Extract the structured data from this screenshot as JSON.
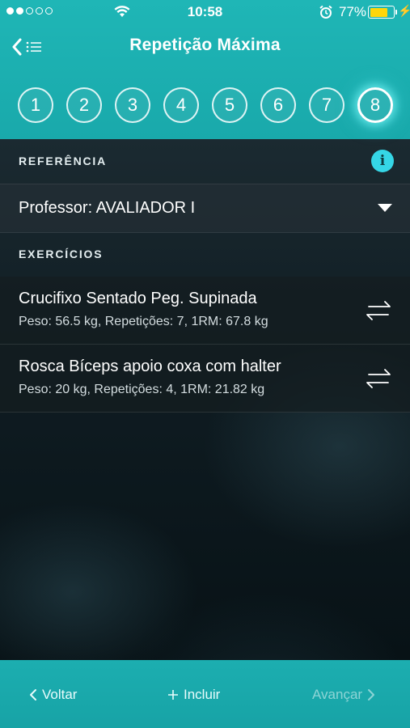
{
  "status_bar": {
    "time": "10:58",
    "battery_percent": "77%",
    "battery_level": 0.77,
    "battery_color": "#ffd60a",
    "signal_bars_filled": 2,
    "signal_bars_total": 5
  },
  "nav": {
    "title": "Repetição Máxima",
    "back_icon": "chevron-left-icon",
    "list_icon": "list-icon"
  },
  "steps": {
    "labels": [
      "1",
      "2",
      "3",
      "4",
      "5",
      "6",
      "7",
      "8"
    ],
    "active": "8"
  },
  "reference": {
    "section_label": "REFERÊNCIA",
    "info_icon": "i",
    "professor_label": "Professor: AVALIADOR I"
  },
  "exercises": {
    "section_label": "EXERCÍCIOS",
    "items": [
      {
        "name": "Crucifixo Sentado Peg. Supinada",
        "detail": "Peso: 56.5 kg, Repetições: 7, 1RM: 67.8 kg"
      },
      {
        "name": "Rosca Bíceps apoio coxa com halter",
        "detail": "Peso: 20 kg, Repetições: 4, 1RM: 21.82 kg"
      }
    ]
  },
  "footer": {
    "back_label": "Voltar",
    "add_label": "Incluir",
    "next_label": "Avançar"
  },
  "colors": {
    "accent": "#1fb6b6",
    "info": "#35d6e6"
  }
}
